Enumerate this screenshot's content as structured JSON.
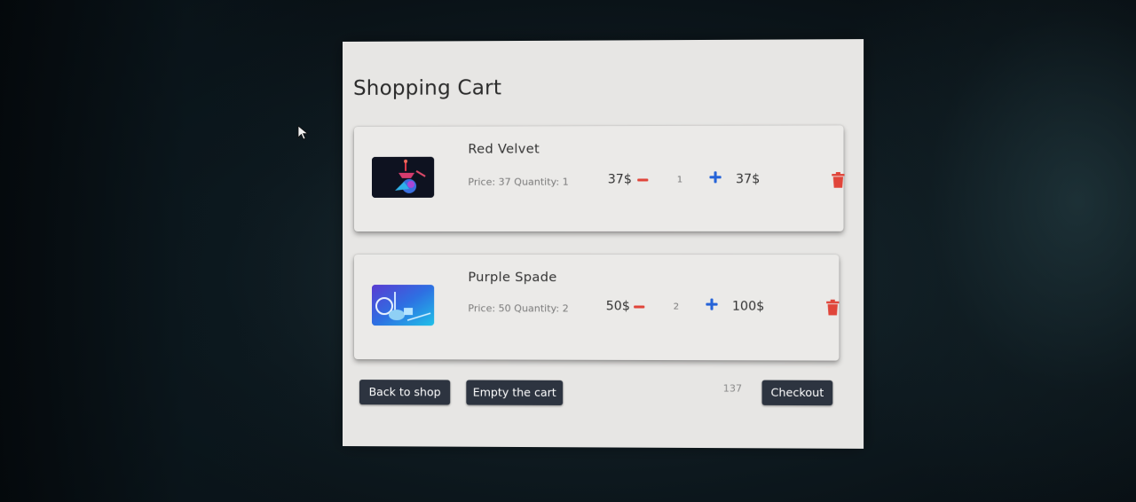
{
  "page": {
    "title": "Shopping Cart"
  },
  "items": [
    {
      "name": "Red Velvet",
      "price_line": "Price: 37 Quantity: 1",
      "unit_price": "37$",
      "quantity": "1",
      "total": "37$",
      "thumbnail_icon": "hookah-image-red"
    },
    {
      "name": "Purple Spade",
      "price_line": "Price: 50 Quantity: 2",
      "unit_price": "50$",
      "quantity": "2",
      "total": "100$",
      "thumbnail_icon": "hookah-image-blue"
    }
  ],
  "footer": {
    "back_label": "Back to shop",
    "empty_label": "Empty the cart",
    "total": "137",
    "checkout_label": "Checkout"
  },
  "colors": {
    "panel_background": "#e7e6e4",
    "button_background": "#2d3440",
    "minus_color": "#e0453a",
    "plus_color": "#2563d8",
    "trash_color": "#e0453a"
  },
  "icons": {
    "decrease": "minus-icon",
    "increase": "plus-icon",
    "remove": "trash-icon",
    "pointer": "mouse-cursor-icon"
  }
}
